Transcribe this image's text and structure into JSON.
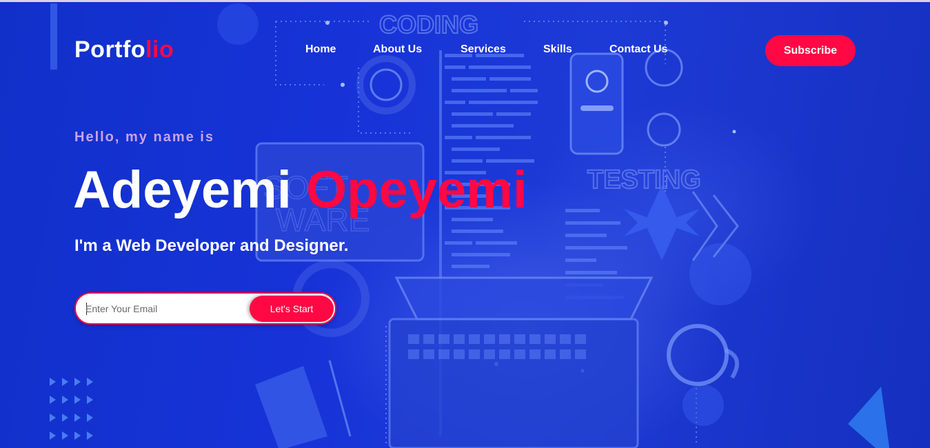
{
  "brand": {
    "prefix": "Portfo",
    "accent": "lio"
  },
  "nav": {
    "items": [
      {
        "label": "Home"
      },
      {
        "label": "About Us"
      },
      {
        "label": "Services"
      },
      {
        "label": "Skills"
      },
      {
        "label": "Contact Us"
      }
    ]
  },
  "subscribe_label": "Subscribe",
  "hero": {
    "greeting": "Hello, my name is",
    "first_name": "Adeyemi",
    "last_name": "Opeyemi",
    "role": "I'm a Web Developer and Designer."
  },
  "signup": {
    "placeholder": "Enter Your Email",
    "button_label": "Let's Start"
  },
  "background_text": {
    "coding": "CODING",
    "testing": "TESTING",
    "software_1": "SOFT",
    "software_2": "WARE"
  },
  "colors": {
    "accent": "#ff0844",
    "background": "#1733d8",
    "greeting": "#c7a2ec",
    "text": "#ffffff"
  }
}
